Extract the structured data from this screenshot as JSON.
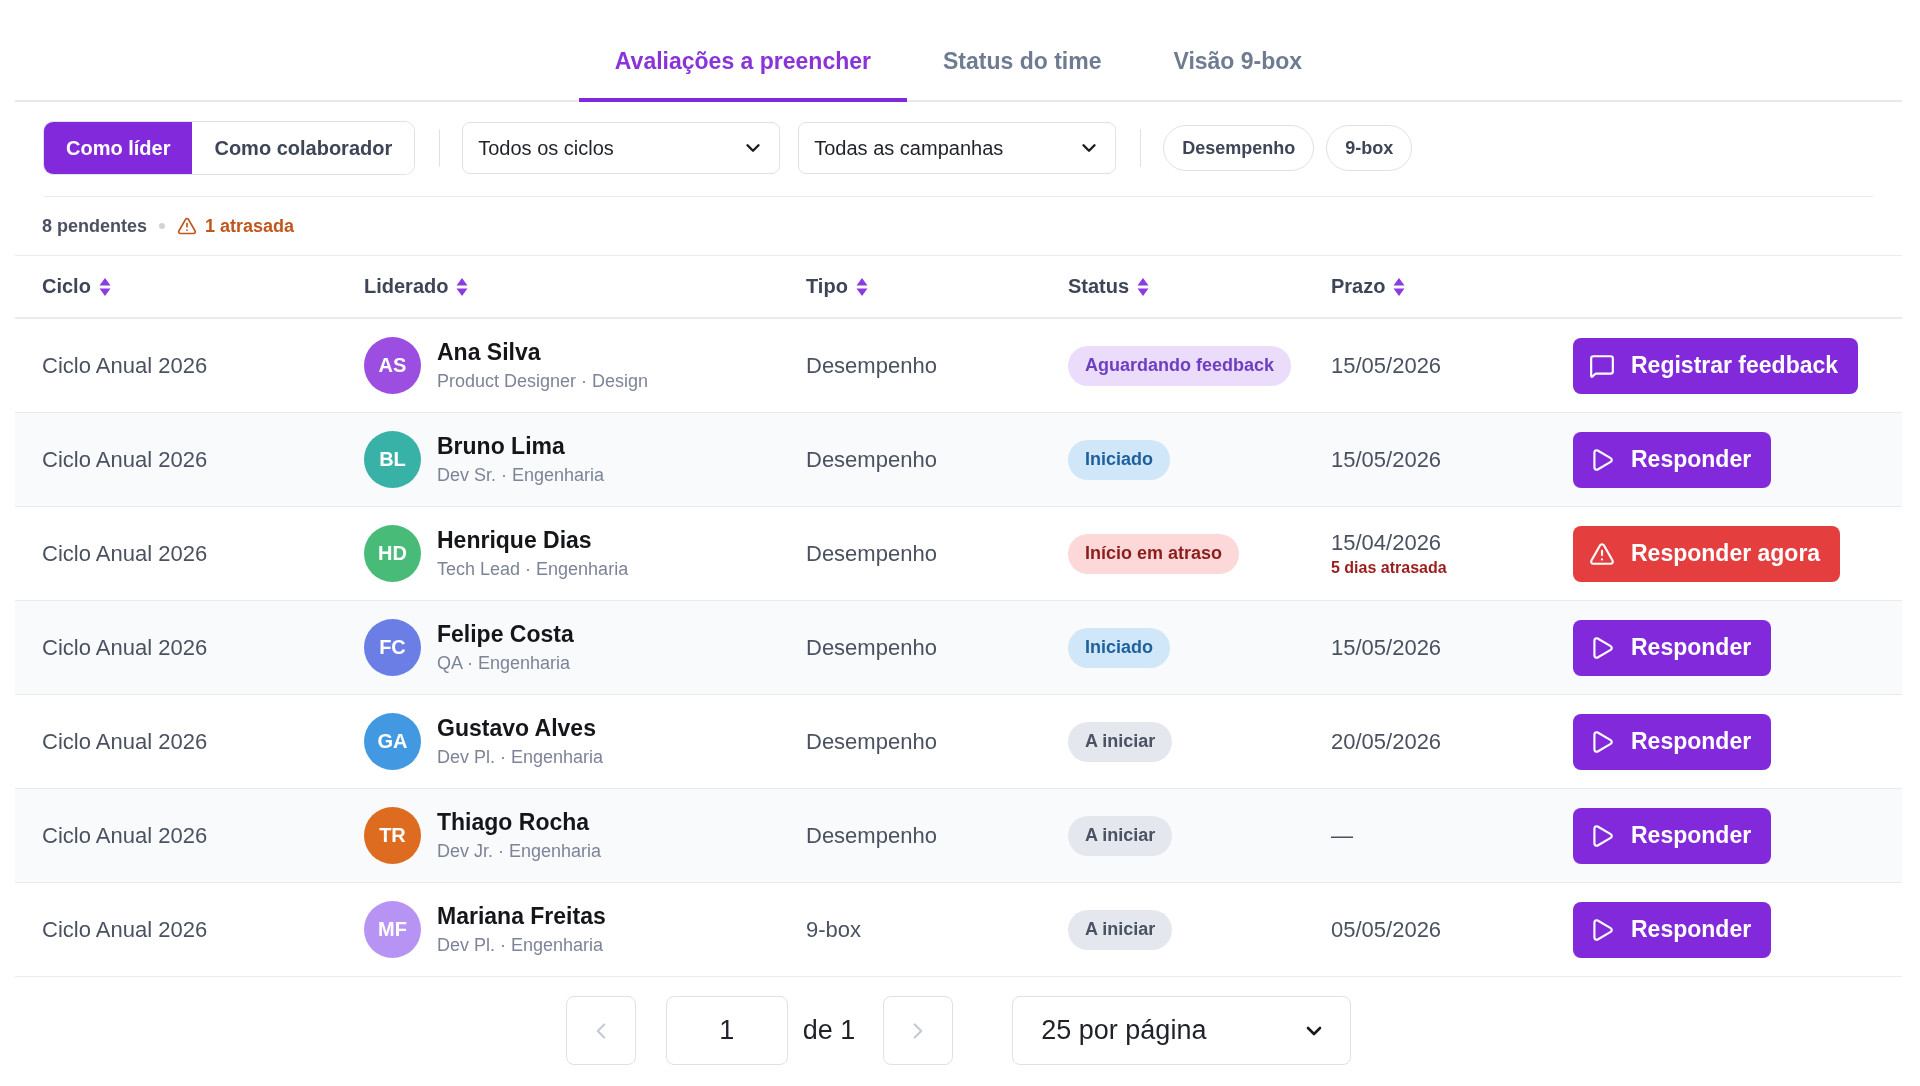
{
  "tabs": [
    {
      "label": "Avaliações a preencher",
      "selected": true
    },
    {
      "label": "Status do time",
      "selected": false
    },
    {
      "label": "Visão 9-box",
      "selected": false
    }
  ],
  "view_as": [
    {
      "label": "Como líder",
      "selected": true
    },
    {
      "label": "Como colaborador",
      "selected": false
    }
  ],
  "filters": [
    {
      "value": "Todos os ciclos"
    },
    {
      "value": "Todas as campanhas"
    }
  ],
  "type_chips": [
    {
      "label": "Desempenho",
      "selected": false
    },
    {
      "label": "9-box",
      "selected": false
    }
  ],
  "summary": {
    "pending": "8 pendentes",
    "overdue": "1 atrasada"
  },
  "table": {
    "columns": [
      {
        "label": "Ciclo",
        "sortable": true
      },
      {
        "label": "Liderado",
        "sortable": true
      },
      {
        "label": "Tipo",
        "sortable": true
      },
      {
        "label": "Status",
        "sortable": true
      },
      {
        "label": "Prazo",
        "sortable": true
      }
    ],
    "rows": [
      {
        "cycle": "Ciclo Anual 2026",
        "person": {
          "initials": "AS",
          "name": "Ana Silva",
          "role": "Product Designer · Design",
          "color": "#9c4ee0"
        },
        "type": "Desempenho",
        "status": {
          "label": "Aguardando feedback",
          "kind": "awaiting"
        },
        "deadline": {
          "date": "15/05/2026"
        },
        "action": {
          "label": "Registrar feedback",
          "kind": "feedback"
        }
      },
      {
        "cycle": "Ciclo Anual 2026",
        "person": {
          "initials": "BL",
          "name": "Bruno Lima",
          "role": "Dev Sr. · Engenharia",
          "color": "#38b2a7"
        },
        "type": "Desempenho",
        "status": {
          "label": "Iniciado",
          "kind": "started"
        },
        "deadline": {
          "date": "15/05/2026"
        },
        "action": {
          "label": "Responder",
          "kind": "respond"
        }
      },
      {
        "cycle": "Ciclo Anual 2026",
        "person": {
          "initials": "HD",
          "name": "Henrique Dias",
          "role": "Tech Lead · Engenharia",
          "color": "#48bb78"
        },
        "type": "Desempenho",
        "status": {
          "label": "Início em atraso",
          "kind": "late"
        },
        "deadline": {
          "date": "15/04/2026",
          "note": "5 dias atrasada"
        },
        "action": {
          "label": "Responder agora",
          "kind": "urgent"
        }
      },
      {
        "cycle": "Ciclo Anual 2026",
        "person": {
          "initials": "FC",
          "name": "Felipe Costa",
          "role": "QA · Engenharia",
          "color": "#6b7ee6"
        },
        "type": "Desempenho",
        "status": {
          "label": "Iniciado",
          "kind": "started"
        },
        "deadline": {
          "date": "15/05/2026"
        },
        "action": {
          "label": "Responder",
          "kind": "respond"
        }
      },
      {
        "cycle": "Ciclo Anual 2026",
        "person": {
          "initials": "GA",
          "name": "Gustavo Alves",
          "role": "Dev Pl. · Engenharia",
          "color": "#4299e1"
        },
        "type": "Desempenho",
        "status": {
          "label": "A iniciar",
          "kind": "not_started"
        },
        "deadline": {
          "date": "20/05/2026"
        },
        "action": {
          "label": "Responder",
          "kind": "respond"
        }
      },
      {
        "cycle": "Ciclo Anual 2026",
        "person": {
          "initials": "TR",
          "name": "Thiago Rocha",
          "role": "Dev Jr. · Engenharia",
          "color": "#dd6b20"
        },
        "type": "Desempenho",
        "status": {
          "label": "A iniciar",
          "kind": "not_started"
        },
        "deadline": {
          "date": "—"
        },
        "action": {
          "label": "Responder",
          "kind": "respond"
        }
      },
      {
        "cycle": "Ciclo Anual 2026",
        "person": {
          "initials": "MF",
          "name": "Mariana Freitas",
          "role": "Dev Pl. · Engenharia",
          "color": "#b794f4"
        },
        "type": "9-box",
        "status": {
          "label": "A iniciar",
          "kind": "not_started"
        },
        "deadline": {
          "date": "05/05/2026"
        },
        "action": {
          "label": "Responder",
          "kind": "respond"
        }
      }
    ]
  },
  "pagination": {
    "previous": {
      "disabled": true
    },
    "page": "1",
    "total": "de 1",
    "next": {
      "disabled": true
    },
    "page_size": "25 por página"
  }
}
